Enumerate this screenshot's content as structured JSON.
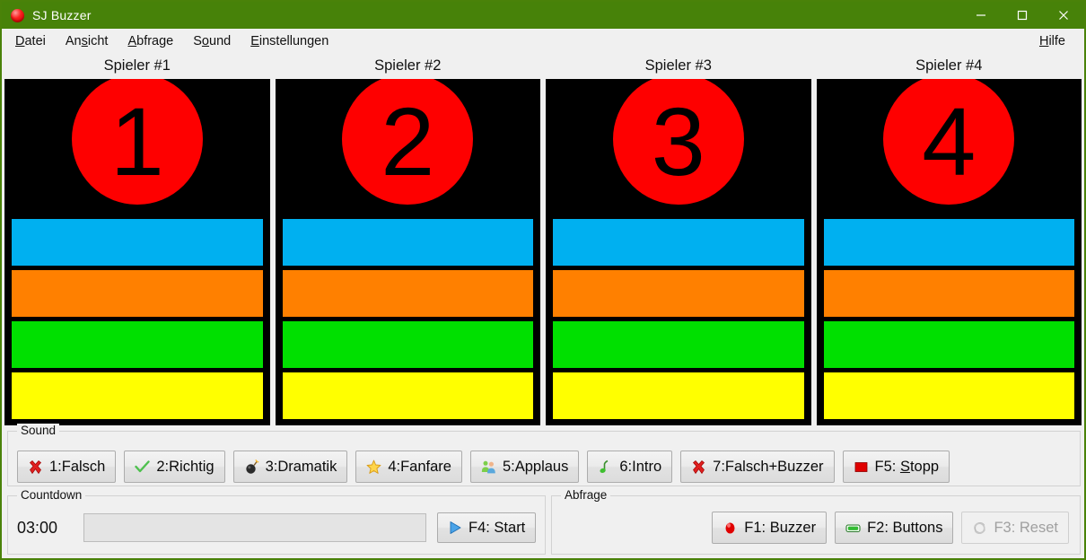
{
  "window": {
    "title": "SJ Buzzer",
    "icon": "buzzer-icon",
    "minimize": "–",
    "maximize": "□",
    "close": "✕",
    "border_color": "#4a8209",
    "titlebar_color": "#478209"
  },
  "menubar": {
    "items": [
      {
        "label": "Datei",
        "accel_index": 0
      },
      {
        "label": "Ansicht",
        "accel_index": 2
      },
      {
        "label": "Abfrage",
        "accel_index": 0
      },
      {
        "label": "Sound",
        "accel_index": 1
      },
      {
        "label": "Einstellungen",
        "accel_index": 0
      }
    ],
    "help": {
      "label": "Hilfe",
      "accel_index": 0
    }
  },
  "players": [
    {
      "title": "Spieler #1",
      "number": "1"
    },
    {
      "title": "Spieler #2",
      "number": "2"
    },
    {
      "title": "Spieler #3",
      "number": "3"
    },
    {
      "title": "Spieler #4",
      "number": "4"
    }
  ],
  "player_colors": {
    "panel_background": "#000000",
    "buzzer": "#fe0000",
    "bars": [
      "#00b0f0",
      "#ff8000",
      "#00e000",
      "#ffff00"
    ],
    "bar_names": [
      "blue-bar",
      "orange-bar",
      "green-bar",
      "yellow-bar"
    ]
  },
  "sound": {
    "legend": "Sound",
    "buttons": [
      {
        "label": "1:Falsch",
        "icon": "red-x-icon"
      },
      {
        "label": "2:Richtig",
        "icon": "green-check-icon"
      },
      {
        "label": "3:Dramatik",
        "icon": "bomb-icon"
      },
      {
        "label": "4:Fanfare",
        "icon": "star-icon"
      },
      {
        "label": "5:Applaus",
        "icon": "people-icon"
      },
      {
        "label": "6:Intro",
        "icon": "music-note-icon"
      },
      {
        "label": "7:Falsch+Buzzer",
        "icon": "red-x-icon"
      },
      {
        "label": "F5: Stopp",
        "icon": "stop-square-icon",
        "accel_char": "S",
        "accel_in": "Stopp"
      }
    ]
  },
  "countdown": {
    "legend": "Countdown",
    "value": "03:00",
    "progress_percent": 0,
    "start_button": {
      "label": "F4: Start",
      "icon": "play-triangle-icon"
    }
  },
  "abfrage": {
    "legend": "Abfrage",
    "buttons": [
      {
        "label": "F1: Buzzer",
        "icon": "buzzer-icon",
        "disabled": false
      },
      {
        "label": "F2: Buttons",
        "icon": "green-button-icon",
        "disabled": false
      },
      {
        "label": "F3: Reset",
        "icon": "reset-icon",
        "disabled": true
      }
    ]
  }
}
